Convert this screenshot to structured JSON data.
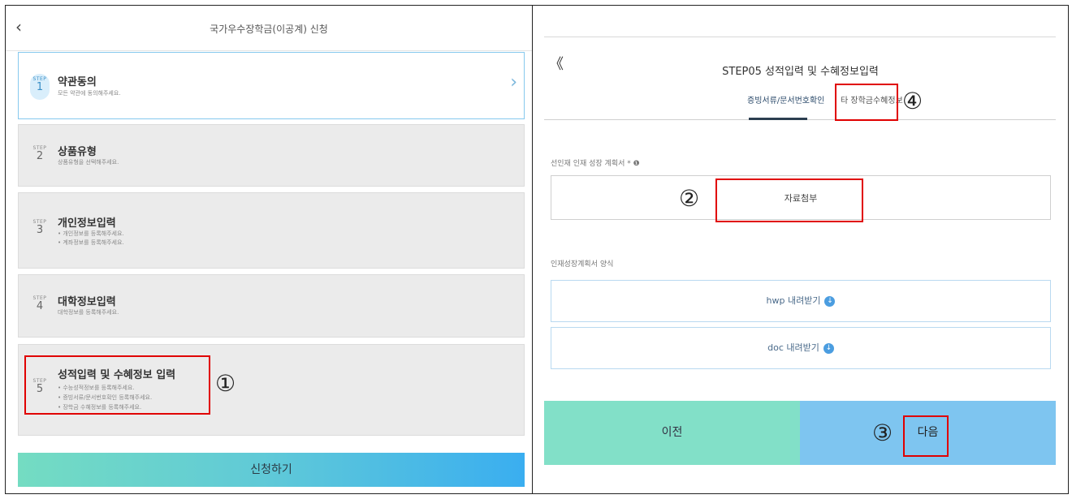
{
  "left": {
    "header": {
      "back_icon": "chevron-left-icon",
      "back_glyph": "‹",
      "title": "국가우수장학금(이공계) 신청"
    },
    "steps": [
      {
        "label": "STEP",
        "num": "1",
        "title": "약관동의",
        "desc": [
          "모든 약관에 동의해주세요."
        ],
        "active": true,
        "chevron": "›"
      },
      {
        "label": "STEP",
        "num": "2",
        "title": "상품유형",
        "desc": [
          "상품유형을 선택해주세요."
        ]
      },
      {
        "label": "STEP",
        "num": "3",
        "title": "개인정보입력",
        "desc": [
          "• 개인정보를 등록해주세요.",
          "• 계좌정보를 등록해주세요."
        ]
      },
      {
        "label": "STEP",
        "num": "4",
        "title": "대학정보입력",
        "desc": [
          "대학정보를 등록해주세요."
        ]
      },
      {
        "label": "STEP",
        "num": "5",
        "title": "성적입력 및 수혜정보 입력",
        "desc": [
          "• 수능성적정보를 등록해주세요.",
          "• 증빙서류/문서번호확인 등록해주세요.",
          "• 장학금 수혜정보를 등록해주세요."
        ]
      }
    ],
    "submit_label": "신청하기",
    "annotation_1": "①"
  },
  "right": {
    "back_glyph": "《",
    "title": "STEP05 성적입력 및 수혜정보입력",
    "tabs": [
      {
        "label": "증빙서류/문서번호확인",
        "active": true
      },
      {
        "label": "타 장학금수혜정보",
        "active": false
      }
    ],
    "field_label": "선인재 인재 성장 계획서 * ❶",
    "attach_label": "자료첨부",
    "form_label": "인재성장계획서 양식",
    "hwp_label": "hwp 내려받기",
    "doc_label": "doc 내려받기",
    "download_glyph": "↓",
    "prev_label": "이전",
    "next_label": "다음",
    "annotation_2": "②",
    "annotation_3": "③",
    "annotation_4": "④"
  },
  "colors": {
    "annotation_box": "#e00000",
    "active_border": "#86c9ee",
    "card_bg": "#ebebeb",
    "prev_bg": "#82e0c8",
    "next_bg": "#7ec5f0",
    "tab_underline": "#2c3e50"
  }
}
